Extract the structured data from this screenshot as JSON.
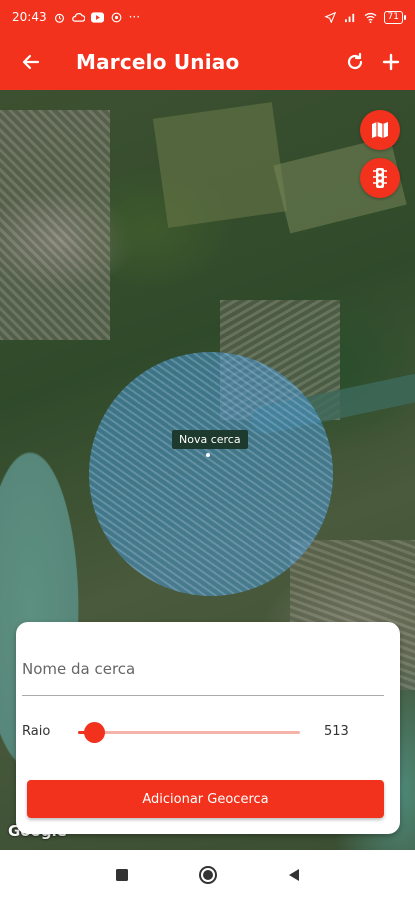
{
  "status_bar": {
    "time": "20:43",
    "more": "···",
    "battery": "71"
  },
  "app_bar": {
    "title": "Marcelo Uniao",
    "icons": [
      "arrow-left-icon",
      "refresh-icon",
      "plus-icon"
    ]
  },
  "map": {
    "fab_icons": [
      "map-icon",
      "traffic-light-icon"
    ],
    "fence_label": "Nova cerca",
    "attribution": "Google"
  },
  "form": {
    "name_placeholder": "Nome da cerca",
    "name_value": "",
    "radius_label": "Raio",
    "radius_value": "513",
    "radius_fraction": 0.0,
    "submit_label": "Adicionar Geocerca"
  },
  "colors": {
    "accent": "#f2321c",
    "fence_fill": "#4696d2"
  },
  "nav_bar": {
    "icons": [
      "square-icon",
      "circle-icon",
      "back-triangle-icon"
    ]
  }
}
